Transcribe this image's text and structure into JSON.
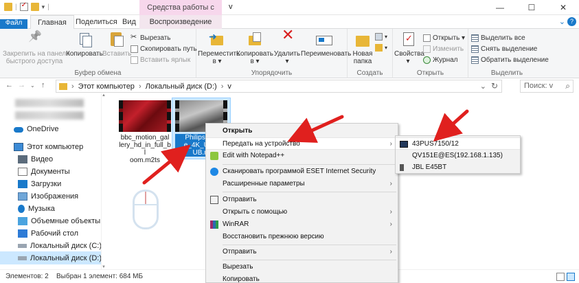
{
  "window": {
    "title": "v",
    "context_tab_header": "Средства работы с видео",
    "controls": [
      "—",
      "☐",
      "✕"
    ]
  },
  "tabs": {
    "file": "Файл",
    "home": "Главная",
    "share": "Поделиться",
    "view": "Вид",
    "play": "Воспроизведение"
  },
  "ribbon": {
    "clipboard": {
      "pin": [
        "Закрепить на панели",
        "быстрого доступа"
      ],
      "copy": "Копировать",
      "paste": "Вставить",
      "cut": "Вырезать",
      "copy_path": "Скопировать путь",
      "paste_shortcut": "Вставить ярлык",
      "label": "Буфер обмена"
    },
    "organize": {
      "move": [
        "Переместить",
        "в ▾"
      ],
      "copy_to": [
        "Копировать",
        "в ▾"
      ],
      "delete": [
        "Удалить",
        "▾"
      ],
      "rename": "Переименовать",
      "label": "Упорядочить"
    },
    "create": {
      "new_folder": [
        "Новая",
        "папка"
      ],
      "label": "Создать"
    },
    "open": {
      "properties": [
        "Свойства",
        "▾"
      ],
      "open": "Открыть ▾",
      "edit": "Изменить",
      "history": "Журнал",
      "label": "Открыть"
    },
    "select": {
      "select_all": "Выделить все",
      "select_none": "Снять выделение",
      "invert": "Обратить выделение",
      "label": "Выделить"
    }
  },
  "address": {
    "parts": [
      "Этот компьютер",
      "Локальный диск (D:)",
      "v"
    ],
    "search_placeholder": "Поиск: v"
  },
  "navpane": {
    "onedrive": "OneDrive",
    "this_pc": "Этот компьютер",
    "items": [
      "Видео",
      "Документы",
      "Загрузки",
      "Изображения",
      "Музыка",
      "Объемные объекты",
      "Рабочий стол",
      "Локальный диск (C:)",
      "Локальный диск (D:)"
    ]
  },
  "files": [
    {
      "name": "bbc_motion_gallery_hd_in_full_bloom.m2ts",
      "name_lines": [
        "bbc_motion_gal",
        "lery_hd_in_full_bl",
        "oom.m2ts"
      ],
      "selected": false
    },
    {
      "name": "Philips_Be e_4K_UHD UB.m",
      "name_lines": [
        "Philips_Be",
        "e_4K_UHD",
        "UB.m"
      ],
      "selected": true
    }
  ],
  "status": {
    "count": "Элементов: 2",
    "selection": "Выбран 1 элемент: 684 МБ"
  },
  "context_menu": {
    "items": [
      {
        "label": "Открыть",
        "bold": true
      },
      {
        "label": "Передать на устройство",
        "submenu": true,
        "highlight": true
      },
      {
        "label": "Edit with Notepad++",
        "icon": "notepad-plus-plus-icon"
      },
      {
        "label": "Сканировать программой ESET Internet Security",
        "icon": "eset-icon"
      },
      {
        "label": "Расширенные параметры",
        "submenu": true
      },
      {
        "label": "Отправить",
        "icon": "share-icon"
      },
      {
        "label": "Открыть с помощью",
        "submenu": true
      },
      {
        "label": "WinRAR",
        "submenu": true,
        "icon": "winrar-icon"
      },
      {
        "label": "Восстановить прежнюю версию"
      },
      {
        "label": "Отправить",
        "submenu": true
      },
      {
        "label": "Вырезать"
      },
      {
        "label": "Копировать"
      }
    ]
  },
  "submenu": {
    "items": [
      "43PUS7150/12",
      "QV151E@ES(192.168.1.135)",
      "JBL E45BT"
    ]
  },
  "colors": {
    "accent": "#1979ca",
    "context_tab": "#f7d7ec",
    "arrow": "#e0201e",
    "selection": "#cce8ff"
  }
}
